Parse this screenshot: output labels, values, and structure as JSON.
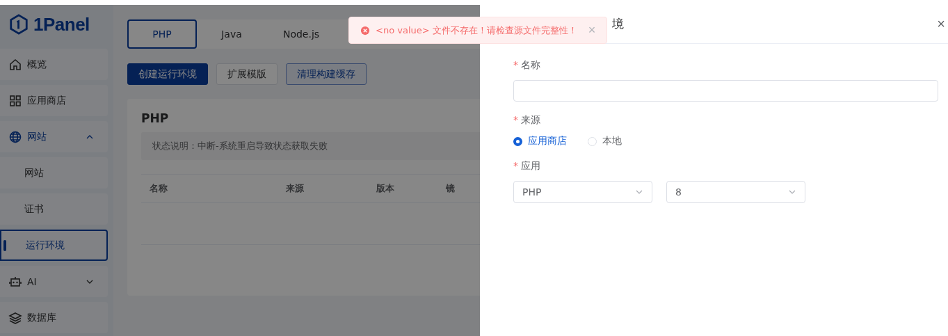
{
  "logo": {
    "text": "1Panel"
  },
  "sidebar": {
    "items": [
      {
        "label": "概览"
      },
      {
        "label": "应用商店"
      },
      {
        "label": "网站",
        "expanded": true,
        "children": [
          {
            "label": "网站",
            "selected": false
          },
          {
            "label": "证书",
            "selected": false
          },
          {
            "label": "运行环境",
            "selected": true
          }
        ]
      },
      {
        "label": "AI",
        "expanded": false
      },
      {
        "label": "数据库"
      }
    ]
  },
  "tabs": [
    {
      "label": "PHP",
      "selected": true
    },
    {
      "label": "Java",
      "selected": false
    },
    {
      "label": "Node.js",
      "selected": false
    }
  ],
  "buttons": [
    {
      "label": "创建运行环境",
      "kind": "primary"
    },
    {
      "label": "扩展模版",
      "kind": "default"
    },
    {
      "label": "清理构建缓存",
      "kind": "plain"
    }
  ],
  "card": {
    "title": "PHP",
    "note": "状态说明：中断-系统重启导致状态获取失败",
    "table": {
      "columns": [
        "名称",
        "来源",
        "版本",
        "镜"
      ]
    }
  },
  "drawer": {
    "title": "境",
    "close": "×",
    "form": [
      {
        "kind": "input",
        "label": "名称",
        "mark": "*"
      },
      {
        "kind": "radio",
        "label": "来源",
        "mark": "*",
        "options": [
          {
            "label": "应用商店",
            "selected": true
          },
          {
            "label": "本地",
            "selected": false
          }
        ]
      },
      {
        "kind": "selects",
        "label": "应用",
        "mark": "*",
        "values": [
          "PHP",
          "8"
        ]
      }
    ]
  },
  "toast": {
    "message": "<no value> 文件不存在！请检查源文件完整性！",
    "close": "×"
  }
}
